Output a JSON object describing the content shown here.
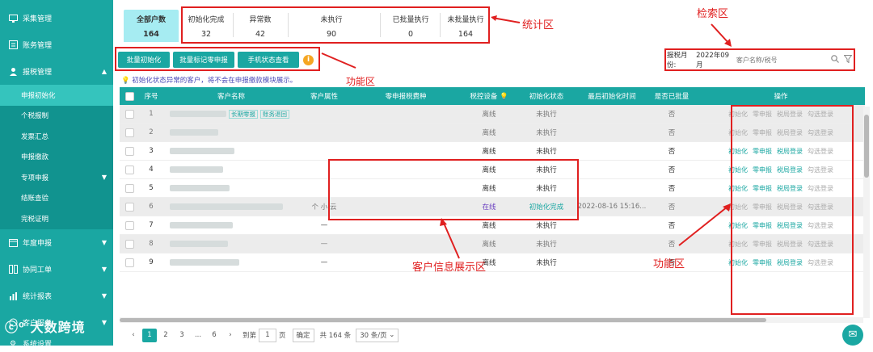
{
  "sidebar": {
    "items": [
      {
        "label": "采集管理",
        "icon": "monitor-icon"
      },
      {
        "label": "账务管理",
        "icon": "ledger-icon"
      },
      {
        "label": "报税管理",
        "icon": "user-icon"
      }
    ],
    "sub_items": [
      {
        "label": "申报初始化",
        "active": true
      },
      {
        "label": "个税报制"
      },
      {
        "label": "发票汇总"
      },
      {
        "label": "申报缴款"
      },
      {
        "label": "专项申报"
      },
      {
        "label": "结账查验"
      },
      {
        "label": "完税证明"
      }
    ],
    "bottom_items": [
      {
        "label": "年度申报",
        "icon": "calendar-icon"
      },
      {
        "label": "协同工单",
        "icon": "workorder-icon"
      },
      {
        "label": "统计报表",
        "icon": "chart-icon"
      },
      {
        "label": "客户服务",
        "icon": "service-icon"
      },
      {
        "label": "系统设置",
        "icon": "gear-icon"
      }
    ]
  },
  "stats": {
    "all": {
      "label": "全部户数",
      "value": "164"
    },
    "init_done": {
      "label": "初始化完成",
      "value": "32"
    },
    "abnormal": {
      "label": "异常数",
      "value": "42"
    },
    "not_run": {
      "label": "未执行",
      "value": "90"
    },
    "batch_run": {
      "label": "已批量执行",
      "value": "0"
    },
    "batch_not": {
      "label": "未批量执行",
      "value": "164"
    }
  },
  "toolbar": {
    "batch_init": "批量初始化",
    "batch_mark": "批量标记零申报",
    "phone_status": "手机状态查看"
  },
  "notice": "初始化状态异常的客户，将不会在申报缴款模块展示。",
  "search": {
    "period_label": "报税月份:",
    "period_value": "2022年09月",
    "placeholder": "客户名称/税号"
  },
  "table": {
    "headers": [
      "序号",
      "客户名称",
      "客户属性",
      "零申报税费种",
      "税控设备",
      "初始化状态",
      "最后初始化时间",
      "是否已批量",
      "操作"
    ],
    "rows": [
      {
        "no": "1",
        "tags": [
          "长期零报",
          "账务退回"
        ],
        "attr": "",
        "device": "离线",
        "status": "未执行",
        "time": "",
        "batch": "否",
        "grey": true
      },
      {
        "no": "2",
        "tags": [],
        "attr": "",
        "device": "离线",
        "status": "未执行",
        "time": "",
        "batch": "否",
        "grey": true
      },
      {
        "no": "3",
        "tags": [],
        "attr": "",
        "device": "离线",
        "status": "未执行",
        "time": "",
        "batch": "否",
        "grey": false
      },
      {
        "no": "4",
        "tags": [],
        "attr": "",
        "device": "离线",
        "status": "未执行",
        "time": "",
        "batch": "否",
        "grey": false
      },
      {
        "no": "5",
        "tags": [],
        "attr": "",
        "device": "离线",
        "status": "未执行",
        "time": "",
        "batch": "否",
        "grey": false
      },
      {
        "no": "6",
        "tags": [],
        "attr": "个 小 云",
        "device": "在线",
        "status": "初始化完成",
        "time": "2022-08-16 15:16...",
        "batch": "否",
        "grey": true
      },
      {
        "no": "7",
        "tags": [],
        "attr": "—",
        "device": "离线",
        "status": "未执行",
        "time": "",
        "batch": "否",
        "grey": false
      },
      {
        "no": "8",
        "tags": [],
        "attr": "—",
        "device": "离线",
        "status": "未执行",
        "time": "",
        "batch": "否",
        "grey": true
      },
      {
        "no": "9",
        "tags": [],
        "attr": "—",
        "device": "离线",
        "status": "未执行",
        "time": "",
        "batch": "否",
        "grey": false
      }
    ],
    "ops": [
      "初始化",
      "零申报",
      "税局登录",
      "勾选登录"
    ]
  },
  "pager": {
    "pages": [
      "1",
      "2",
      "3",
      "...",
      "6"
    ],
    "goto_label": "到第",
    "goto_value": "1",
    "page_unit": "页",
    "confirm": "确定",
    "total": "共 164 条",
    "size": "30 条/页"
  },
  "annotations": {
    "stats": "统计区",
    "search": "检索区",
    "toolbar": "功能区",
    "info": "客户信息展示区",
    "ops": "功能区"
  },
  "watermark": "大数跨境"
}
